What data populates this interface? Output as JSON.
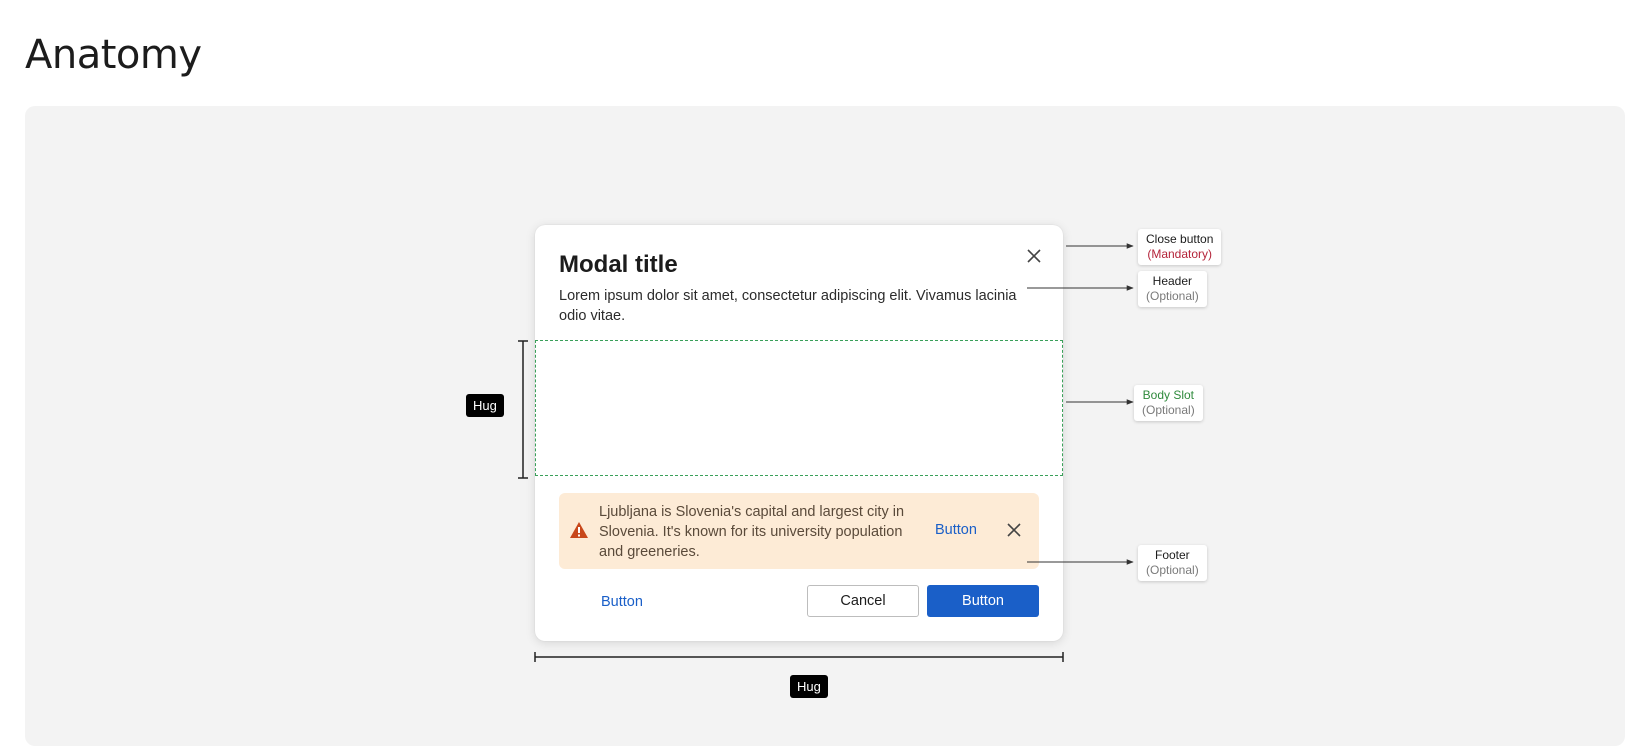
{
  "page": {
    "title": "Anatomy"
  },
  "modal": {
    "title": "Modal title",
    "description": "Lorem ipsum dolor sit amet, consectetur adipiscing elit. Vivamus lacinia odio vitae.",
    "close_icon": "close-icon"
  },
  "notification": {
    "icon": "warning-icon",
    "text": "Ljubljana is Slovenia's capital and largest city in Slovenia. It's known for its university population and greeneries.",
    "action_label": "Button",
    "close_icon": "close-icon"
  },
  "footer": {
    "link_label": "Button",
    "cancel_label": "Cancel",
    "primary_label": "Button"
  },
  "measurements": {
    "vertical_label": "Hug",
    "horizontal_label": "Hug"
  },
  "callouts": {
    "close_button": {
      "name": "Close button",
      "status": "(Mandatory)"
    },
    "header": {
      "name": "Header",
      "status": "(Optional)"
    },
    "body_slot": {
      "name": "Body Slot",
      "status": "(Optional)"
    },
    "footer": {
      "name": "Footer",
      "status": "(Optional)"
    }
  },
  "colors": {
    "canvas": "#f3f3f3",
    "primary": "#1a5fc8",
    "warning_bg": "#fdebd6",
    "warning_icon": "#c8471a",
    "body_slot_border": "#3aa05a",
    "mandatory": "#b4243a"
  }
}
